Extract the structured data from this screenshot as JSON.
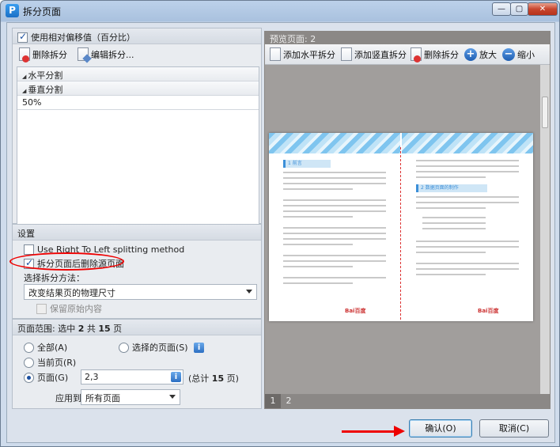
{
  "window": {
    "title": "拆分页面",
    "icon_glyph": "P",
    "min_glyph": "—",
    "max_glyph": "▢",
    "close_glyph": "✕"
  },
  "left": {
    "use_relative_offset": {
      "label": "使用相对偏移值（百分比）",
      "checked": true
    },
    "toolbar": {
      "delete_split": "删除拆分",
      "edit_split": "编辑拆分..."
    },
    "tree": {
      "horizontal": "水平分割",
      "vertical": "垂直分割",
      "value": "50%"
    },
    "settings": {
      "header": "设置",
      "rtl_label": "Use Right To Left splitting method",
      "rtl_checked": false,
      "delete_source_label": "拆分页面后删除源页面",
      "delete_source_checked": true,
      "method_label": "选择拆分方法：",
      "method_value": "改变结果页的物理尺寸",
      "keep_content_label": "保留原始内容",
      "keep_content_checked": false
    },
    "range": {
      "header_prefix": "页面范围: 选中 ",
      "selected": "2",
      "header_mid": " 共 ",
      "total": "15",
      "header_suffix": " 页",
      "all_label": "全部(A)",
      "selected_pages_label": "选择的页面(S)",
      "current_label": "当前页(R)",
      "pages_label": "页面(G)",
      "pages_value": "2,3",
      "total_prefix": "(总计 ",
      "total_count": "15",
      "total_suffix": " 页)",
      "apply_label": "应用到:",
      "apply_value": "所有页面",
      "selected_option": "pages"
    }
  },
  "preview": {
    "header": "预览页面: 2",
    "toolbar": {
      "add_horizontal": "添加水平拆分",
      "add_vertical": "添加竖直拆分",
      "delete_split": "删除拆分",
      "zoom_in": "放大",
      "zoom_out": "缩小"
    },
    "page_tabs": [
      "1",
      "2"
    ],
    "active_tab": "1",
    "page": {
      "heading_left": "1 前言",
      "heading_right": "2 数据页面的制作",
      "footer_logo": "Bai百度"
    }
  },
  "buttons": {
    "ok": "确认(O)",
    "cancel": "取消(C)"
  },
  "colors": {
    "annotation": "#e00000",
    "accent": "#1b4fa0"
  }
}
